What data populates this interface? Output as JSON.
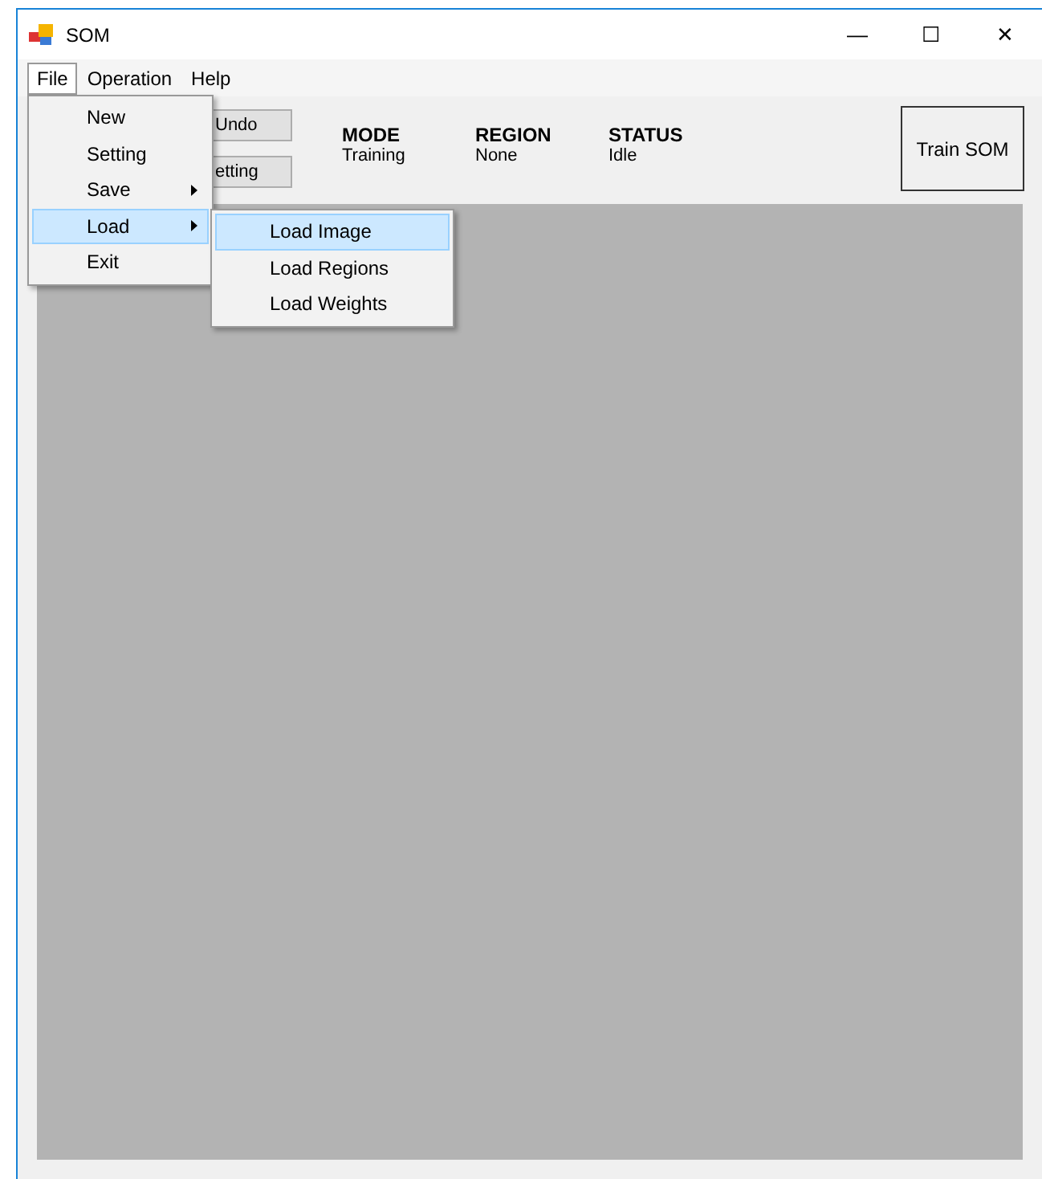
{
  "window": {
    "title": "SOM",
    "controls": [
      "—",
      "☐",
      "✕"
    ]
  },
  "menu_bar": [
    {
      "label": "File",
      "selected": true
    },
    {
      "label": "Operation",
      "selected": false
    },
    {
      "label": "Help",
      "selected": false
    }
  ],
  "toolbar": {
    "buttons": [
      "Undo",
      "etting"
    ],
    "info": [
      {
        "heading": "MODE",
        "value": "Training"
      },
      {
        "heading": "REGION",
        "value": "None"
      },
      {
        "heading": "STATUS",
        "value": "Idle"
      }
    ],
    "train_button": "Train SOM"
  },
  "file_menu": [
    {
      "label": "New",
      "submenu": false,
      "selected": false
    },
    {
      "label": "Setting",
      "submenu": false,
      "selected": false
    },
    {
      "label": "Save",
      "submenu": true,
      "selected": false
    },
    {
      "label": "Load",
      "submenu": true,
      "selected": true
    },
    {
      "label": "Exit",
      "submenu": false,
      "selected": false
    }
  ],
  "load_submenu": [
    {
      "label": "Load Image",
      "selected": true
    },
    {
      "label": "Load Regions",
      "selected": false
    },
    {
      "label": "Load Weights",
      "selected": false
    }
  ]
}
